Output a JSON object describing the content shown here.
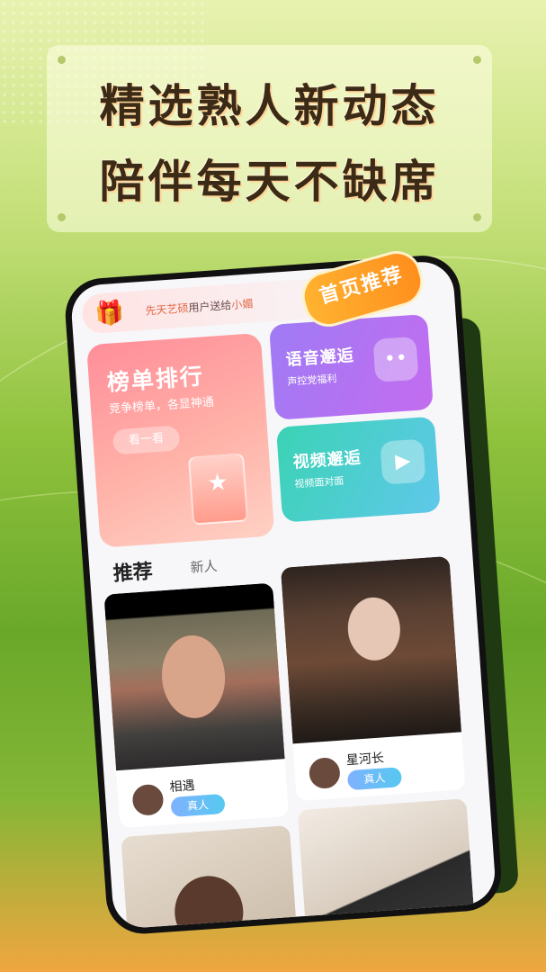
{
  "headline": {
    "line1": "精选熟人新动态",
    "line2": "陪伴每天不缺席"
  },
  "badge": "首页推荐",
  "gift_bar": {
    "sender": "先天艺硕",
    "middle": "用户送给",
    "receiver": "小媚"
  },
  "cards": {
    "rank": {
      "title": "榜单排行",
      "subtitle": "竞争榜单，各显神通",
      "button": "看一看"
    },
    "voice": {
      "title": "语音邂逅",
      "subtitle": "声控党福利"
    },
    "video": {
      "title": "视频邂逅",
      "subtitle": "视频面对面"
    }
  },
  "tabs": {
    "active": "推荐",
    "other": "新人"
  },
  "feed": [
    {
      "name": "相遇",
      "tag": "真人"
    },
    {
      "name": "星河长",
      "tag": "真人"
    }
  ],
  "colors": {
    "accent": "#ff8f1d",
    "rank_card": "#ff8e9a",
    "voice_card": "#a97bf4",
    "video_card": "#3bd3b5"
  }
}
